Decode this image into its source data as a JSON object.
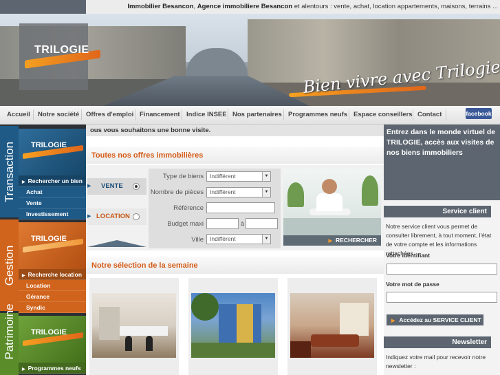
{
  "top": {
    "tagline_bold1": "Immobilier Besancon",
    "tagline_sep1": ", ",
    "tagline_bold2": "Agence immobiliere Besancon",
    "tagline_rest": " et alentours : vente, achat, location appartements, maisons, terrains ..."
  },
  "banner": {
    "logo_text": "TRILOGIE",
    "slogan": "Bien vivre avec Trilogie"
  },
  "nav": {
    "items": [
      "Accueil",
      "Notre société",
      "Offres d'emploi",
      "Financement",
      "Indice INSEE",
      "Nos partenaires",
      "Programmes neufs",
      "Espace conseillers",
      "Contact"
    ],
    "facebook_label": "facebook"
  },
  "left": {
    "sections": [
      {
        "title": "Transaction",
        "logo": "TRILOGIE",
        "items": [
          "Rechercher un bien",
          "Achat",
          "Vente",
          "Investissement"
        ],
        "color": "#1f5a87"
      },
      {
        "title": "Gestion",
        "logo": "TRILOGIE",
        "items": [
          "Recherche location",
          "Location",
          "Gérance",
          "Syndic"
        ],
        "color": "#d0641c"
      },
      {
        "title": "Patrimoine",
        "logo": "TRILOGIE",
        "items": [
          "Programmes neufs"
        ],
        "color": "#5a8c2a"
      }
    ]
  },
  "welcome_text": "ous vous souhaitons une bonne visite.",
  "offers": {
    "title": "Toutes nos offres immobilières",
    "tab_vente": "VENTE",
    "tab_location": "LOCATION",
    "selected_tab": "VENTE",
    "fields": {
      "type_label": "Type de biens",
      "type_value": "Indifférent",
      "rooms_label": "Nombre de pièces",
      "rooms_value": "Indifférent",
      "ref_label": "Référence",
      "ref_value": "",
      "budget_label": "Budget maxi",
      "budget_sep": "à",
      "budget_min": "",
      "budget_max": "",
      "city_label": "Ville",
      "city_value": "Indifférent"
    },
    "search_label": "RECHERCHER"
  },
  "selection": {
    "title": "Notre sélection de la semaine"
  },
  "right": {
    "intro": "Entrez dans le monde virtuel de TRILOGIE, accès aux visites de nos biens immobiliers",
    "service_title": "Service client",
    "service_text": "Notre service client vous permet de consulter librement, à tout moment, l'état de votre compte et les informations rattachées.",
    "id_label": "Votre identifiant",
    "id_value": "",
    "pwd_label": "Votre mot de passe",
    "pwd_value": "",
    "access_label": "Accédez au SERVICE CLIENT",
    "newsletter_title": "Newsletter",
    "newsletter_text": "Indiquez votre mail pour recevoir notre newsletter :"
  },
  "colors": {
    "accent_orange": "#d55a16",
    "header_gray": "#5d6670",
    "transaction_blue": "#1f5a87",
    "gestion_orange": "#d0641c",
    "patrimoine_green": "#5a8c2a",
    "facebook_blue": "#3b5998"
  },
  "icons": {
    "arrow": "triangle-right-icon",
    "dropdown": "chevron-down-icon"
  }
}
